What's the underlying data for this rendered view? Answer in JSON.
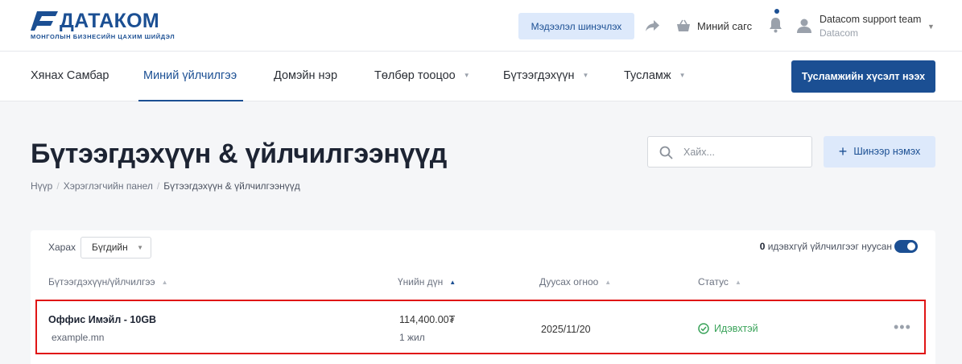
{
  "brand": {
    "name": "ДАТАКОМ",
    "tagline": "МОНГОЛЫН БИЗНЕСИЙН ЦАХИМ ШИЙДЭЛ",
    "color": "#1b4f93"
  },
  "header": {
    "renew_label": "Мэдээлэл шинэчлэх",
    "cart_label": "Миний сагс",
    "user_name": "Datacom support team",
    "user_org": "Datacom"
  },
  "nav": {
    "items": [
      {
        "label": "Хянах Самбар"
      },
      {
        "label": "Миний үйлчилгээ"
      },
      {
        "label": "Домэйн нэр"
      },
      {
        "label": "Төлбөр тооцоо"
      },
      {
        "label": "Бүтээгдэхүүн"
      },
      {
        "label": "Тусламж"
      }
    ],
    "active_item": "Миний үйлчилгээ",
    "support_button": "Тусламжийн хүсэлт нээх"
  },
  "page": {
    "title": "Бүтээгдэхүүн & үйлчилгээнүүд",
    "breadcrumb": [
      "Нүүр",
      "Хэрэглэгчийн панел",
      "Бүтээгдэхүүн & үйлчилгээнүүд"
    ],
    "search_placeholder": "Хайх...",
    "add_button": "Шинээр нэмэх"
  },
  "table": {
    "view_label": "Харах",
    "view_value": "Бүгдийн",
    "hidden_count": "0",
    "hidden_text": "идэвхгүй үйлчилгээг нуусан",
    "hidden_toggle_on": true,
    "columns": [
      "Бүтээгдэхүүн/үйлчилгээ",
      "Үнийн дүн",
      "Дуусах огноо",
      "Статус"
    ],
    "rows": [
      {
        "product": "Оффис Имэйл - 10GB",
        "domain": "example.mn",
        "price": "114,400.00₮",
        "period": "1 жил",
        "due_date": "2025/11/20",
        "status": "Идэвхтэй",
        "status_color": "#3aa35a"
      }
    ]
  }
}
